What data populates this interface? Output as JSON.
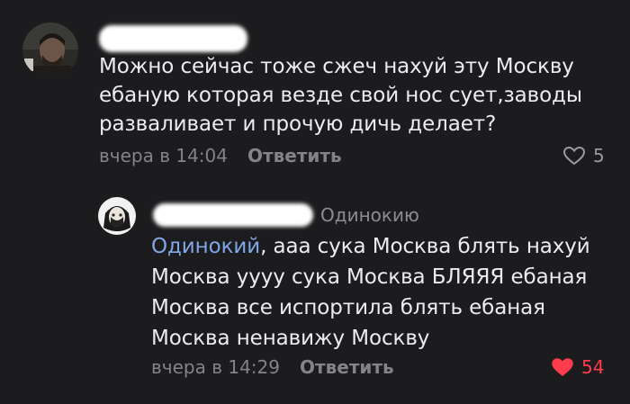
{
  "comments": [
    {
      "text": "Можно сейчас тоже сжеч нахуй эту Москву ебаную которая везде свой нос сует,заводы разваливает и прочую дичь делает?",
      "time": "вчера в 14:04",
      "reply_label": "Ответить",
      "likes": "5",
      "liked": false
    },
    {
      "reply_to": "Одинокию",
      "mention": "Одинокий",
      "text_after_mention": ", ааа сука Москва блять нахуй Москва уууу сука Москва БЛЯЯЯ ебаная Москва все испортила блять ебаная Москва ненавижу Москву",
      "time": "вчера в 14:29",
      "reply_label": "Ответить",
      "likes": "54",
      "liked": true
    }
  ],
  "colors": {
    "background": "#1c1b1d",
    "mention": "#7fa7e6",
    "like_active": "#ff3b4e",
    "meta": "#838388"
  },
  "icons": {
    "like_outline": "heart-outline-icon",
    "like_filled": "heart-filled-icon"
  }
}
